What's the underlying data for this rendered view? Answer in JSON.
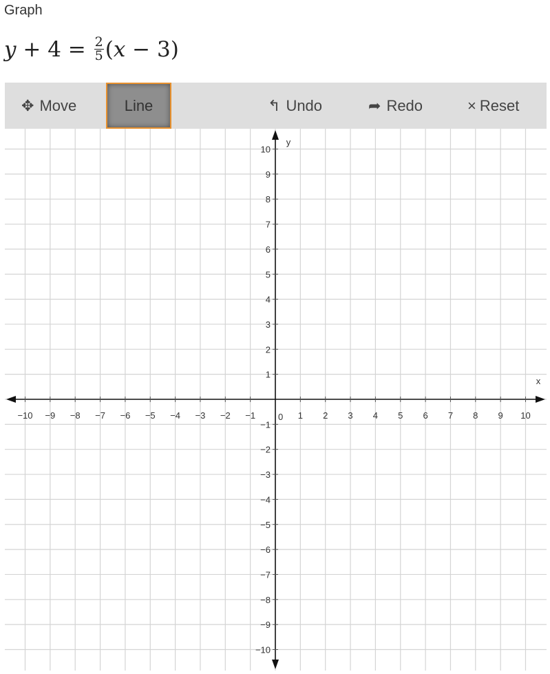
{
  "title": "Graph",
  "equation": {
    "lhs_var": "y",
    "lhs_rest": " + 4 = ",
    "frac_num": "2",
    "frac_den": "5",
    "rhs_open": "(",
    "rhs_var": "x",
    "rhs_rest": " − 3)"
  },
  "toolbar": {
    "move_label": "Move",
    "move_icon": "move-arrows-icon",
    "line_label": "Line",
    "line_active": true,
    "undo_label": "Undo",
    "undo_icon": "undo-arrow-icon",
    "redo_label": "Redo",
    "redo_icon": "redo-arrow-icon",
    "reset_label": "Reset",
    "reset_icon": "x-icon",
    "active_border_color": "#e8912e"
  },
  "chart_data": {
    "type": "line",
    "xlabel": "x",
    "ylabel": "y",
    "xlim": [
      -10,
      10
    ],
    "ylim": [
      -10,
      10
    ],
    "grid": true,
    "x_ticks": [
      -10,
      -9,
      -8,
      -7,
      -6,
      -5,
      -4,
      -3,
      -2,
      -1,
      1,
      2,
      3,
      4,
      5,
      6,
      7,
      8,
      9,
      10
    ],
    "y_ticks": [
      -10,
      -9,
      -8,
      -7,
      -6,
      -5,
      -4,
      -3,
      -2,
      -1,
      1,
      2,
      3,
      4,
      5,
      6,
      7,
      8,
      9,
      10
    ],
    "origin_label": "0",
    "series": []
  }
}
